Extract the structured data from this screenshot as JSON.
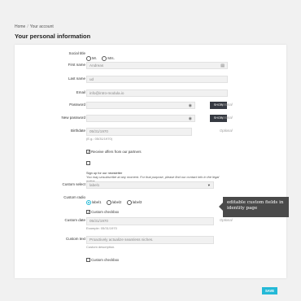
{
  "breadcrumb": {
    "home": "Home",
    "separator": "/",
    "current": "Your account"
  },
  "page_title": "Your personal information",
  "form": {
    "social_title": {
      "label": "Social title",
      "options": [
        "Mr.",
        "Mrs."
      ]
    },
    "first_name": {
      "label": "First name",
      "value": "Andreas"
    },
    "last_name": {
      "label": "Last name",
      "value": "ud"
    },
    "email": {
      "label": "Email",
      "value": "info@intro-modula.io"
    },
    "password": {
      "label": "Password",
      "show_label": "SHOW",
      "optional": "Optional"
    },
    "new_password": {
      "label": "New password",
      "show_label": "SHOW",
      "optional": "Optional"
    },
    "birthdate": {
      "label": "Birthdate",
      "value": "05/31/1970",
      "hint": "(E.g.: 05/31/1970)",
      "optional": "Optional"
    },
    "partners_checkbox": {
      "label": "Receive offers from our partners",
      "checked": true
    },
    "newsletter": {
      "label": "Sign up for our newsletter",
      "note": "You may unsubscribe at any moment. For that purpose, please find our contact info in the legal notice.",
      "checked": false
    },
    "custom_select": {
      "label": "Custom select",
      "value": "label1"
    },
    "custom_radio": {
      "label": "Custom radio",
      "options": [
        "label1",
        "label2",
        "label3"
      ],
      "selected": 0
    },
    "custom_checkbox_1": {
      "label": "Custom checkbox",
      "checked": true
    },
    "custom_date": {
      "label": "Custom date",
      "value": "05/31/1970",
      "hint": "Example: 05/31/1970",
      "optional": "Optional"
    },
    "custom_text": {
      "label": "Custom text",
      "value": "Proactively actualize seamless niches.",
      "hint": "Custom description."
    },
    "custom_checkbox_2": {
      "label": "Custom checkbox",
      "checked": false
    },
    "save_label": "SAVE"
  },
  "tooltip": {
    "text": "editable custom fields in identity page"
  },
  "colors": {
    "accent": "#24b9d7",
    "button_dark": "#363a42",
    "tooltip_bg": "#4a4a4a"
  },
  "icons": {
    "password_toggle": "eye-icon",
    "select_caret": "caret-down-icon"
  }
}
